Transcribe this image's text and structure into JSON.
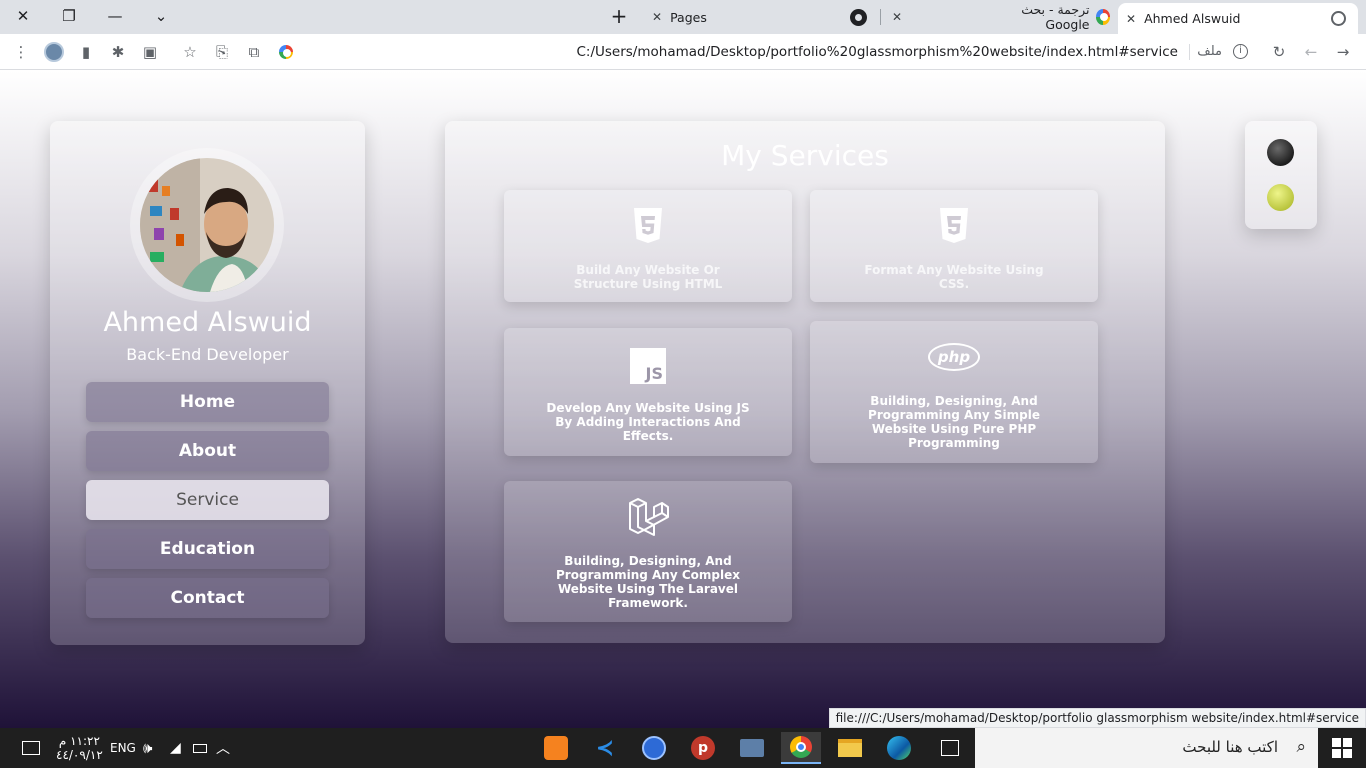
{
  "browser": {
    "tabs": [
      {
        "title": "Pages",
        "icon": "grid-icon"
      },
      {
        "title": "",
        "icon": "github-icon"
      },
      {
        "title": "ترجمة - بحث Google",
        "icon": "google-icon"
      },
      {
        "title": "Ahmed Alswuid",
        "icon": "globe-icon",
        "active": true
      }
    ],
    "url": "C:/Users/mohamad/Desktop/portfolio%20glassmorphism%20website/index.html#service",
    "file_label": "ملف",
    "status_url": "file:///C:/Users/mohamad/Desktop/portfolio glassmorphism website/index.html#service"
  },
  "profile": {
    "name": "Ahmed Alswuid",
    "role": "Back-End Developer",
    "nav": [
      {
        "label": "Home"
      },
      {
        "label": "About"
      },
      {
        "label": "Service",
        "active": true
      },
      {
        "label": "Education"
      },
      {
        "label": "Contact"
      }
    ]
  },
  "services": {
    "title": "My Services",
    "cards": [
      {
        "icon": "html5-icon",
        "text": "Build Any Website Or Structure Using HTML"
      },
      {
        "icon": "css3-icon",
        "text": "Format Any Website Using CSS."
      },
      {
        "icon": "js-icon",
        "icon_text": "JS",
        "text": "Develop Any Website Using JS By Adding Interactions And Effects."
      },
      {
        "icon": "php-icon",
        "icon_text": "php",
        "text": "Building, Designing, And Programming Any Simple Website Using Pure PHP Programming"
      },
      {
        "icon": "laravel-icon",
        "text": "Building, Designing, And Programming Any Complex Website Using The Laravel Framework."
      }
    ]
  },
  "theme_switch": {
    "colors": [
      "#2b2b2b",
      "#d4de5a"
    ]
  },
  "taskbar": {
    "search_placeholder": "اكتب هنا للبحث",
    "time": "١١:٢٢ م",
    "date": "٤٤/٠٩/١٢",
    "lang": "ENG",
    "apps": [
      "xampp-icon",
      "vscode-icon",
      "app-icon",
      "postman-icon",
      "tools-icon",
      "chrome-icon",
      "file-explorer-icon",
      "edge-icon",
      "task-view-icon"
    ]
  }
}
